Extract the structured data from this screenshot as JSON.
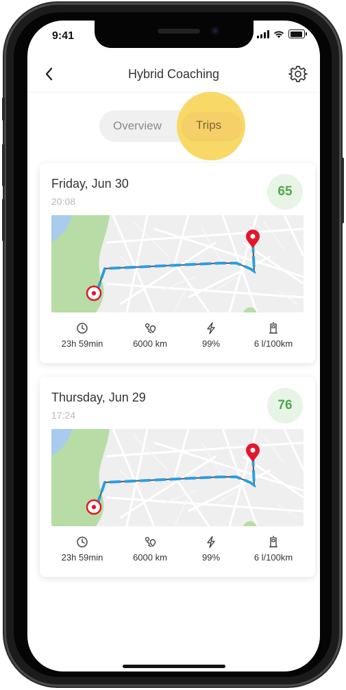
{
  "status_bar": {
    "time": "9:41"
  },
  "nav": {
    "title": "Hybrid Coaching"
  },
  "tabs": {
    "overview": "Overview",
    "trips": "Trips",
    "active": "trips"
  },
  "trips": [
    {
      "date": "Friday, Jun 30",
      "time": "20:08",
      "score": "65",
      "stats": {
        "duration": "23h 59min",
        "distance": "6000 km",
        "efficiency": "99%",
        "consumption": "6 l/100km"
      }
    },
    {
      "date": "Thursday, Jun 29",
      "time": "17:24",
      "score": "76",
      "stats": {
        "duration": "23h 59min",
        "distance": "6000 km",
        "efficiency": "99%",
        "consumption": "6 l/100km"
      }
    }
  ],
  "colors": {
    "accent": "#f8d65e",
    "score_bg": "#e8f4e6",
    "score_text": "#4fa84a",
    "route_blue": "#2a9fe0",
    "pin_red": "#e3172b"
  },
  "icons": {
    "back": "chevron-left-icon",
    "settings": "gear-icon",
    "duration": "clock-icon",
    "distance": "route-icon",
    "efficiency": "lightning-icon",
    "consumption": "fuel-pump-icon"
  }
}
